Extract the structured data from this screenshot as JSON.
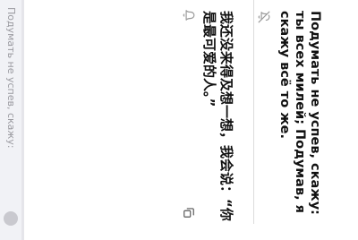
{
  "conversation": {
    "russian_text": "Подумать не успев, скажу: ты всех милей; Подумав, я скажу всё то же.",
    "chinese_text": "我还没来得及想一想，我会说：“你是最可爱的人。”"
  },
  "side_panel": {
    "text": "Подумать не успев, скажу:"
  },
  "icons": {
    "mute": "mute-bell-icon",
    "bell": "bell-icon",
    "copy": "copy-icon"
  }
}
